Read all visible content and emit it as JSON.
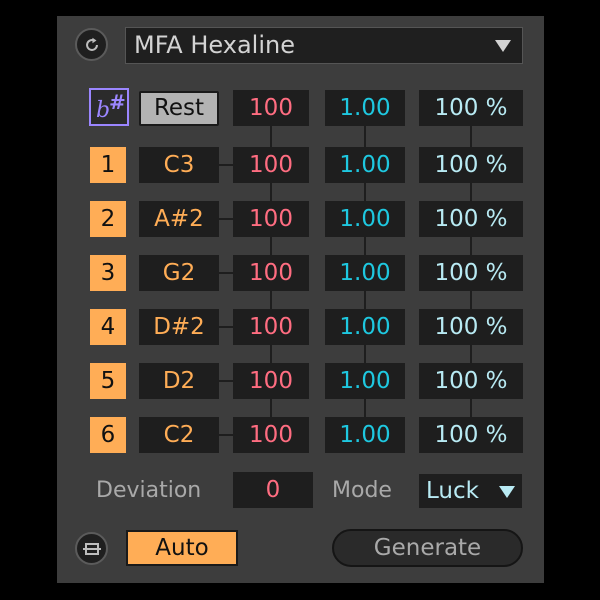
{
  "header": {
    "preset_name": "MFA Hexaline"
  },
  "top_row": {
    "accidental_flat": "b",
    "accidental_sharp": "#",
    "rest_label": "Rest",
    "velocity": "100",
    "probability": "1.00",
    "percent": "100 %"
  },
  "steps": [
    {
      "num": "1",
      "note": "C3",
      "velocity": "100",
      "probability": "1.00",
      "percent": "100 %"
    },
    {
      "num": "2",
      "note": "A#2",
      "velocity": "100",
      "probability": "1.00",
      "percent": "100 %"
    },
    {
      "num": "3",
      "note": "G2",
      "velocity": "100",
      "probability": "1.00",
      "percent": "100 %"
    },
    {
      "num": "4",
      "note": "D#2",
      "velocity": "100",
      "probability": "1.00",
      "percent": "100 %"
    },
    {
      "num": "5",
      "note": "D2",
      "velocity": "100",
      "probability": "1.00",
      "percent": "100 %"
    },
    {
      "num": "6",
      "note": "C2",
      "velocity": "100",
      "probability": "1.00",
      "percent": "100 %"
    }
  ],
  "controls": {
    "deviation_label": "Deviation",
    "deviation_value": "0",
    "mode_label": "Mode",
    "mode_value": "Luck"
  },
  "footer": {
    "auto_label": "Auto",
    "generate_label": "Generate"
  },
  "icons": {
    "refresh": "refresh-icon",
    "dropdown": "triangle-down-icon",
    "lock": "bracket-lock-icon"
  },
  "colors": {
    "orange": "#ffad56",
    "pink": "#ff6d81",
    "cyan": "#1ec8e0",
    "light_cyan": "#b8eaf3",
    "violet": "#9b86ff"
  }
}
